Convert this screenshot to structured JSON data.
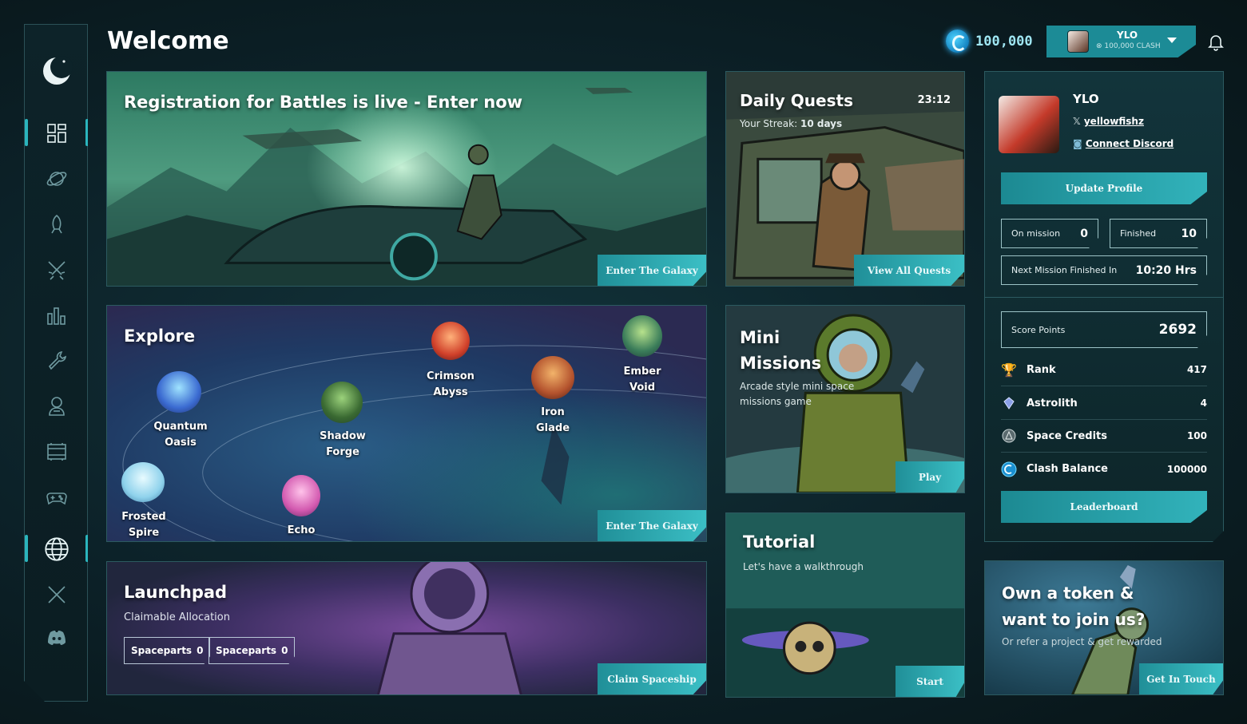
{
  "page": {
    "title": "Welcome"
  },
  "header": {
    "balance": "100,000",
    "user_name": "YLO",
    "user_sub": "100,000 CLASH"
  },
  "sidebar": {
    "items": [
      {
        "name": "dashboard-icon"
      },
      {
        "name": "planet-icon"
      },
      {
        "name": "rocket-icon"
      },
      {
        "name": "crossed-swords-icon"
      },
      {
        "name": "bar-chart-icon"
      },
      {
        "name": "wrench-icon"
      },
      {
        "name": "astronaut-icon"
      },
      {
        "name": "board-icon"
      },
      {
        "name": "gamepad-icon"
      },
      {
        "name": "globe-icon"
      },
      {
        "name": "x-social-icon"
      },
      {
        "name": "discord-icon"
      }
    ]
  },
  "banner": {
    "title": "Registration for Battles is live - Enter now",
    "cta": "Enter The Galaxy"
  },
  "quests": {
    "title": "Daily Quests",
    "timer": "23:12",
    "streak_label": "Your Streak:",
    "streak_value": "10 days",
    "cta": "View All Quests"
  },
  "explore": {
    "title": "Explore",
    "cta": "Enter The Galaxy",
    "planets": [
      {
        "l1": "Quantum",
        "l2": "Oasis"
      },
      {
        "l1": "Shadow",
        "l2": "Forge"
      },
      {
        "l1": "Crimson",
        "l2": "Abyss"
      },
      {
        "l1": "Iron",
        "l2": "Glade"
      },
      {
        "l1": "Ember",
        "l2": "Void"
      },
      {
        "l1": "Frosted",
        "l2": "Spire"
      },
      {
        "l1": "Echo",
        "l2": ""
      }
    ]
  },
  "mini": {
    "title1": "Mini",
    "title2": "Missions",
    "desc1": "Arcade style mini space",
    "desc2": "missions game",
    "cta": "Play"
  },
  "launchpad": {
    "title": "Launchpad",
    "subtitle": "Claimable Allocation",
    "tag1_label": "Spaceparts",
    "tag1_value": "0",
    "tag2_label": "Spaceparts",
    "tag2_value": "0",
    "cta": "Claim Spaceship"
  },
  "tutorial": {
    "title": "Tutorial",
    "subtitle": "Let's have a walkthrough",
    "cta": "Start"
  },
  "profile": {
    "name": "YLO",
    "twitter": "yellowfishz",
    "discord": "Connect Discord",
    "update_btn": "Update Profile",
    "on_mission_label": "On mission",
    "on_mission_value": "0",
    "finished_label": "Finished",
    "finished_value": "10",
    "next_label": "Next Mission Finished In",
    "next_value": "10:20 Hrs",
    "score_label": "Score Points",
    "score_value": "2692",
    "rows": [
      {
        "label": "Rank",
        "value": "417"
      },
      {
        "label": "Astrolith",
        "value": "4"
      },
      {
        "label": "Space Credits",
        "value": "100"
      },
      {
        "label": "Clash Balance",
        "value": "100000"
      }
    ],
    "leaderboard_btn": "Leaderboard"
  },
  "token": {
    "title1": "Own a token &",
    "title2": "want to join us?",
    "subtitle": "Or refer a project & get rewarded",
    "cta": "Get In Touch"
  },
  "colors": {
    "accent": "#2bb5bd",
    "bg": "#0c2128"
  }
}
